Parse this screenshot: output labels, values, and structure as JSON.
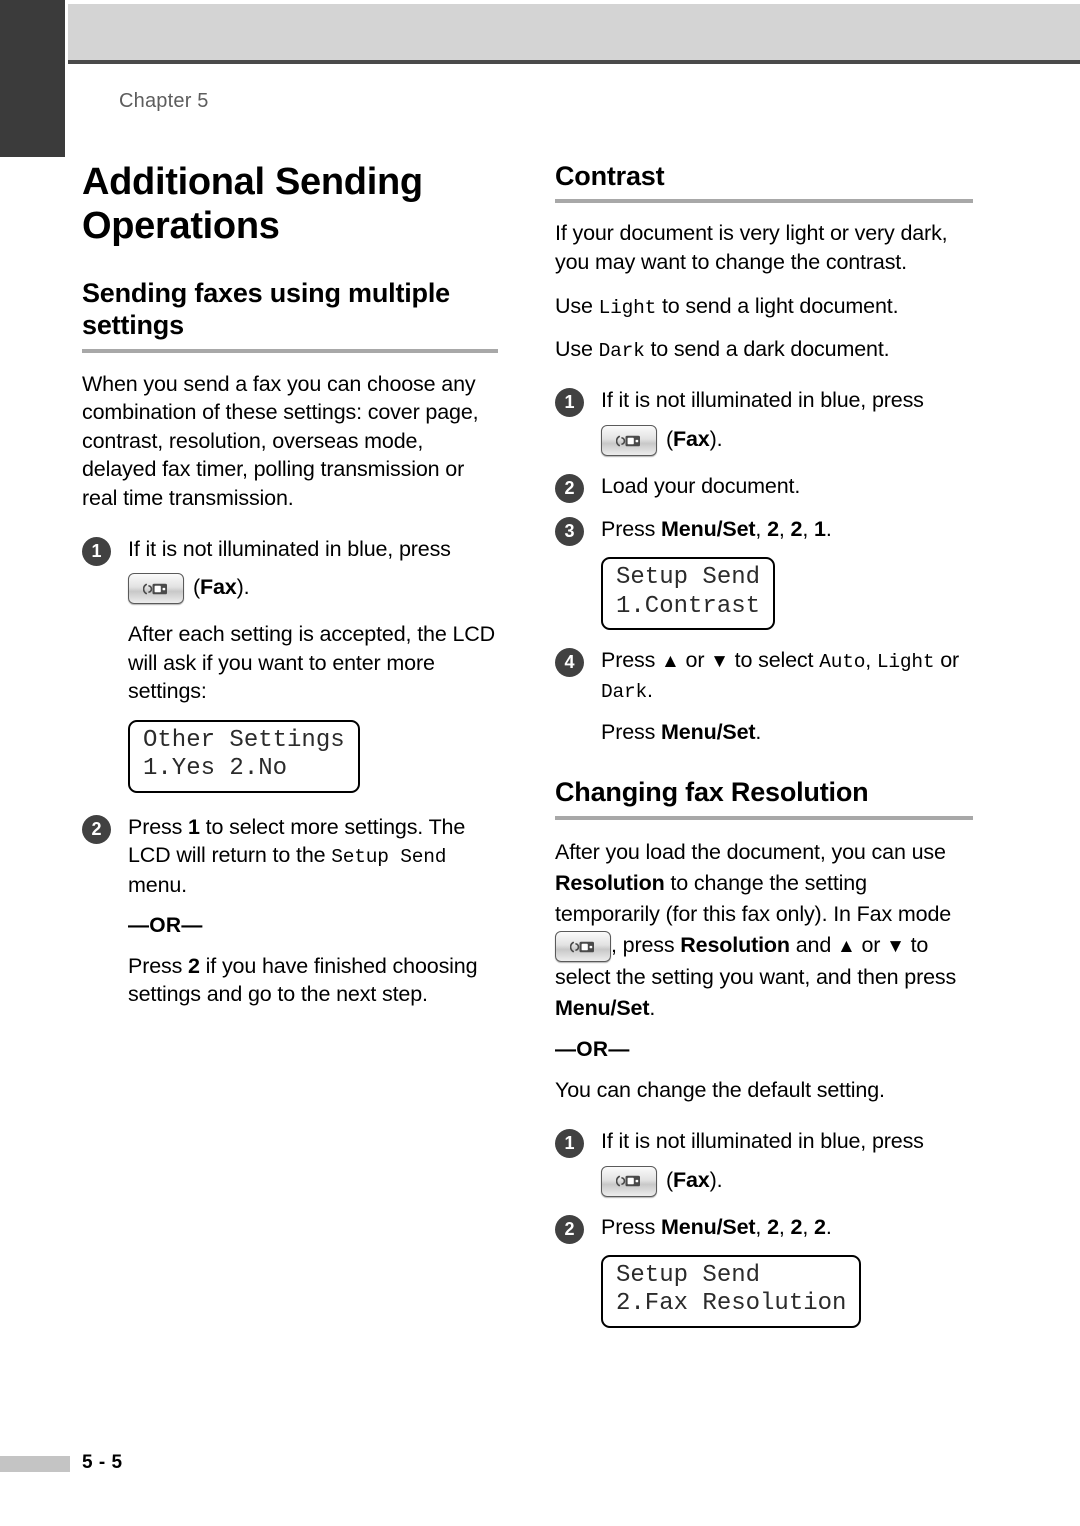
{
  "page": {
    "chapter_label": "Chapter 5",
    "page_number": "5 - 5"
  },
  "left_column": {
    "title": "Additional Sending Operations",
    "section": {
      "heading": "Sending faxes using multiple settings",
      "intro": "When you send a fax you can choose any combination of these settings: cover page, contrast, resolution, overseas mode, delayed fax timer, polling transmission or real time transmission.",
      "steps": [
        {
          "number": "1",
          "text_before_button": "If it is not illuminated in blue, press",
          "button_icon": "fax-button-icon",
          "button_caption_open": "(",
          "button_caption_bold": "Fax",
          "button_caption_close": ").",
          "note": "After each setting is accepted, the LCD will ask if you want to enter more settings:",
          "lcd": {
            "line1": "Other Settings",
            "line2": "1.Yes 2.No"
          }
        },
        {
          "number": "2",
          "text_a1": "Press ",
          "text_a_bold": "1",
          "text_a2": " to select more settings. The LCD will return to the ",
          "text_a_mono": "Setup Send",
          "text_a3": " menu.",
          "or_label": "—OR—",
          "text_b1": "Press ",
          "text_b_bold": "2",
          "text_b2": " if you have finished choosing settings and go to the next step."
        }
      ]
    }
  },
  "right_column": {
    "contrast": {
      "heading": "Contrast",
      "intro": "If your document is very light or very dark, you may want to change the contrast.",
      "use_light_1": "Use ",
      "use_light_mono": "Light",
      "use_light_2": " to send a light document.",
      "use_dark_1": "Use ",
      "use_dark_mono": "Dark",
      "use_dark_2": " to send a dark document.",
      "steps": [
        {
          "number": "1",
          "text_before_button": "If it is not illuminated in blue, press",
          "button_icon": "fax-button-icon",
          "button_caption_open": "(",
          "button_caption_bold": "Fax",
          "button_caption_close": ")."
        },
        {
          "number": "2",
          "text": "Load your document."
        },
        {
          "number": "3",
          "text_1": "Press ",
          "bold_1": "Menu/Set",
          "text_2": ", ",
          "bold_2": "2",
          "text_3": ", ",
          "bold_3": "2",
          "text_4": ", ",
          "bold_4": "1",
          "text_5": ".",
          "lcd": {
            "line1": "Setup Send",
            "line2": "1.Contrast"
          }
        },
        {
          "number": "4",
          "text_1": "Press ",
          "arrow_up": "▲",
          "text_2": " or ",
          "arrow_down": "▼",
          "text_3": " to select ",
          "mono_1": "Auto",
          "text_4": ", ",
          "mono_2": "Light",
          "text_5": " or ",
          "mono_3": "Dark",
          "text_6": ".",
          "press_1": "Press ",
          "press_bold": "Menu/Set",
          "press_2": "."
        }
      ]
    },
    "resolution": {
      "heading": "Changing fax Resolution",
      "para_1": "After you load the document, you can use ",
      "para_bold_1": "Resolution",
      "para_2": " to change the setting temporarily (for this fax only). In Fax mode ",
      "button_icon": "fax-button-icon",
      "para_3": ", press ",
      "para_bold_2": "Resolution",
      "para_4": " and ",
      "arrow_up": "▲",
      "para_5": " or ",
      "arrow_down": "▼",
      "para_6": " to select the setting you want, and then press ",
      "para_bold_3": "Menu/Set",
      "para_7": ".",
      "or_label": "—OR—",
      "default_text": "You can change the default setting.",
      "steps": [
        {
          "number": "1",
          "text_before_button": "If it is not illuminated in blue, press",
          "button_icon": "fax-button-icon",
          "button_caption_open": "(",
          "button_caption_bold": "Fax",
          "button_caption_close": ")."
        },
        {
          "number": "2",
          "text_1": "Press ",
          "bold_1": "Menu/Set",
          "text_2": ", ",
          "bold_2": "2",
          "text_3": ", ",
          "bold_3": "2",
          "text_4": ", ",
          "bold_4": "2",
          "text_5": ".",
          "lcd": {
            "line1": "Setup Send",
            "line2": "2.Fax Resolution"
          }
        }
      ]
    }
  },
  "colors": {
    "corner_block": "#3b3b3b",
    "header_band": "#d4d4d4",
    "rule_gray": "#a8a8a8",
    "step_circle": "#414141",
    "footer_bar": "#c4c4c4"
  }
}
